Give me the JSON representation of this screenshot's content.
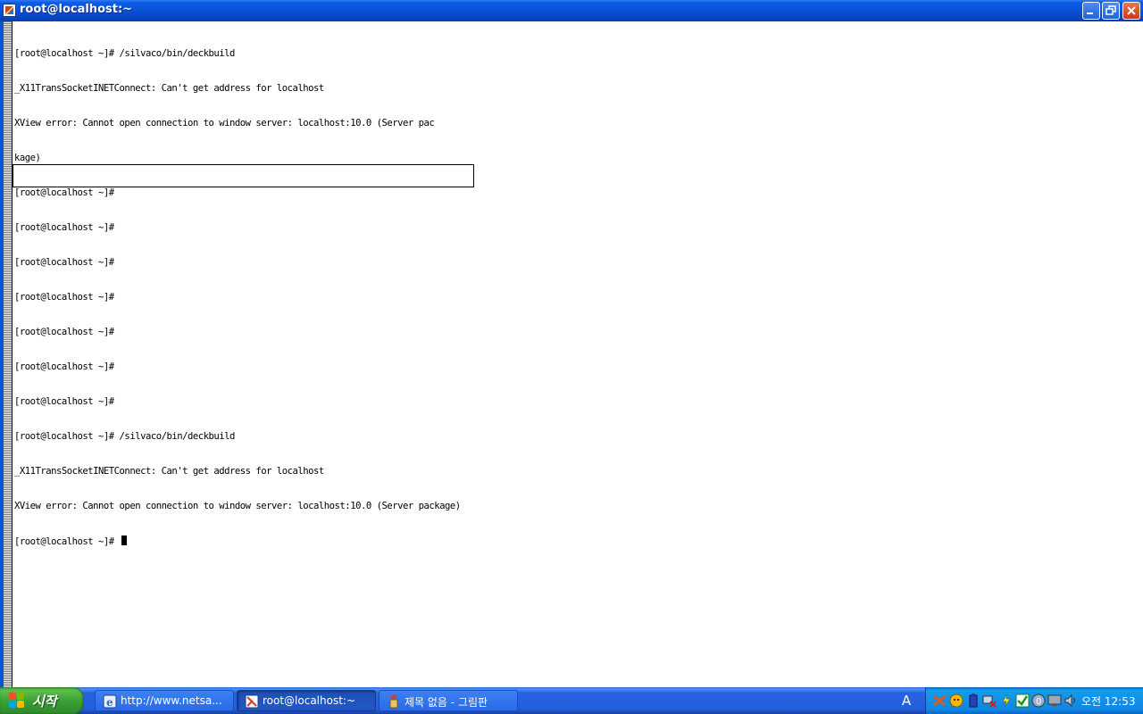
{
  "window": {
    "title": "root@localhost:~",
    "buttons": {
      "minimize": "minimize-icon",
      "maximize": "restore-icon",
      "close": "close-icon"
    }
  },
  "terminal": {
    "lines": [
      "[root@localhost ~]# /silvaco/bin/deckbuild",
      "_X11TransSocketINETConnect: Can't get address for localhost",
      "XView error: Cannot open connection to window server: localhost:10.0 (Server pac",
      "kage)",
      "[root@localhost ~]#",
      "[root@localhost ~]#",
      "[root@localhost ~]#",
      "[root@localhost ~]#",
      "[root@localhost ~]#",
      "[root@localhost ~]#",
      "[root@localhost ~]#",
      "[root@localhost ~]# /silvaco/bin/deckbuild",
      "_X11TransSocketINETConnect: Can't get address for localhost",
      "XView error: Cannot open connection to window server: localhost:10.0 (Server package)",
      "[root@localhost ~]# "
    ]
  },
  "taskbar": {
    "start_label": "시작",
    "tasks": [
      {
        "label": "http://www.netsa...",
        "icon": "internet-explorer-icon"
      },
      {
        "label": "root@localhost:~",
        "icon": "terminal-icon"
      },
      {
        "label": "제목 없음 - 그림판",
        "icon": "paint-icon"
      }
    ],
    "language": "A",
    "clock": "오전 12:53"
  },
  "colors": {
    "titlebar": "#0a52d6",
    "taskbar": "#245edb",
    "start_button": "#3a9d33",
    "tray": "#1290e8"
  }
}
